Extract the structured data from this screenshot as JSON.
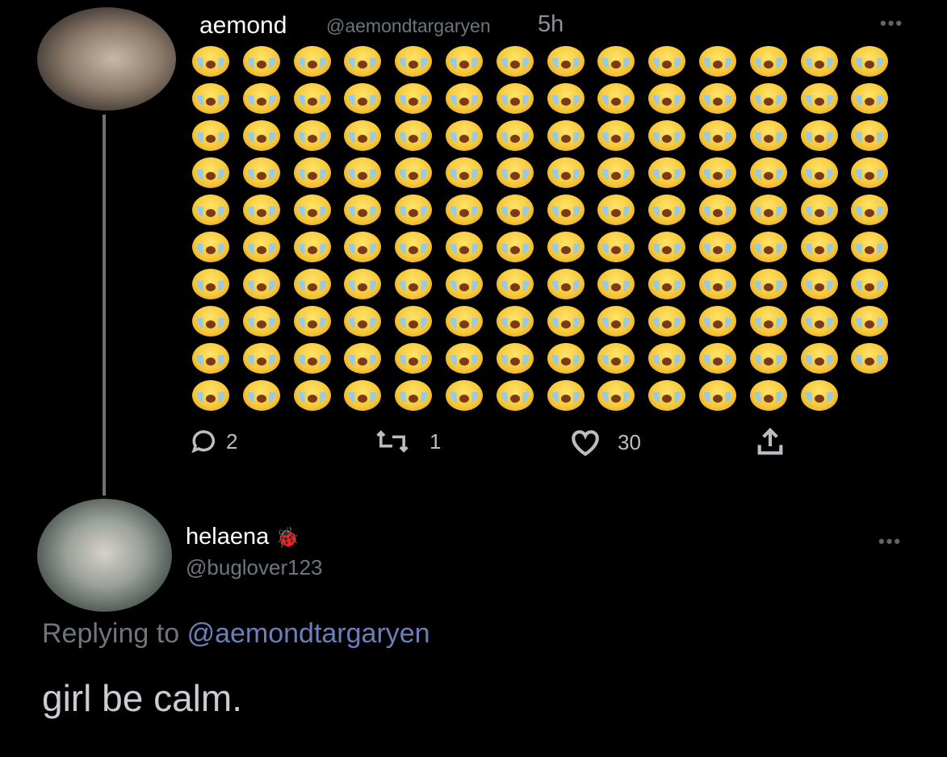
{
  "tweet": {
    "display_name": "aemond",
    "handle": "@aemondtargaryen",
    "time": "5h",
    "more_label": "•••",
    "emoji_name": "loudly-crying-face-emoji",
    "emoji_rows": [
      14,
      14,
      14,
      14,
      14,
      14,
      14,
      14,
      14,
      13
    ],
    "actions": {
      "reply_count": "2",
      "retweet_count": "1",
      "like_count": "30"
    }
  },
  "reply": {
    "display_name": "helaena",
    "name_emoji": "🐞",
    "handle": "@buglover123",
    "more_label": "•••",
    "replying_prefix": "Replying to",
    "replying_handle": "@aemondtargaryen",
    "text": "girl be calm."
  },
  "colors": {
    "background": "#000000",
    "name": "#ffffff",
    "handle": "#6e767d",
    "mention": "#6d7fb8",
    "thread_line": "#6f7276"
  }
}
